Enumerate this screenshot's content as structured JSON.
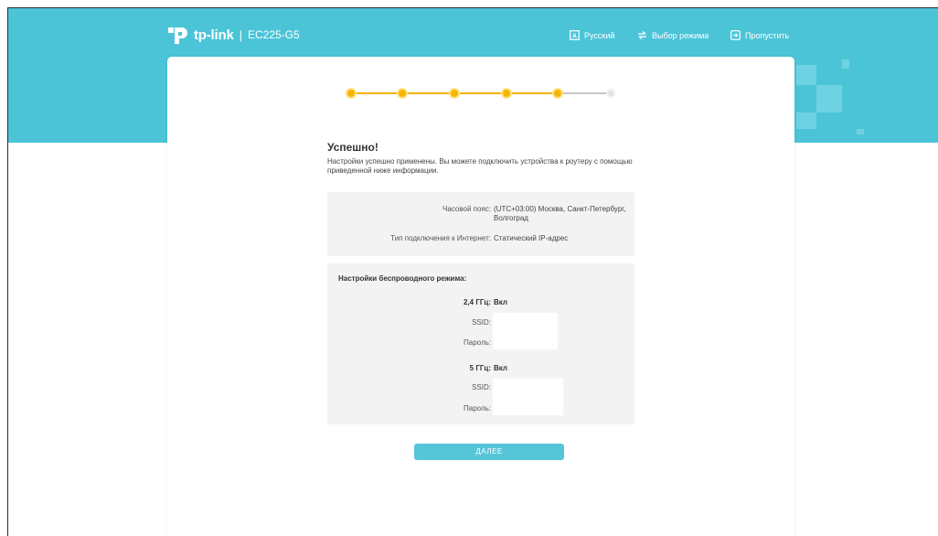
{
  "header": {
    "logo_text": "tp-link",
    "separator": "|",
    "model": "EC225-G5",
    "nav": [
      {
        "label": "Русский",
        "icon": "language-icon"
      },
      {
        "label": "Выбор режима",
        "icon": "mode-switch-icon"
      },
      {
        "label": "Пропустить",
        "icon": "skip-icon"
      }
    ]
  },
  "stepper": {
    "total": 6,
    "completed": 5
  },
  "main": {
    "title": "Успешно!",
    "description": "Настройки успешно применены. Вы можете подключить устройства к роутеру с помощью приведенной ниже информации.",
    "summary": {
      "timezone_label": "Часовой пояс:",
      "timezone_value": "(UTC+03:00) Москва, Санкт-Петербург, Волгоград",
      "connection_label": "Тип подключения к Интернет:",
      "connection_value": "Статический IP-адрес"
    },
    "wireless": {
      "section_label": "Настройки беспроводного режима:",
      "band24": {
        "label": "2,4 ГГц:",
        "status": "Вкл",
        "ssid_label": "SSID:",
        "password_label": "Пароль:"
      },
      "band5": {
        "label": "5 ГГц:",
        "status": "Вкл",
        "ssid_label": "SSID:",
        "password_label": "Пароль:"
      }
    },
    "next_button": "ДАЛЕЕ"
  },
  "colors": {
    "banner": "#4cc4d8",
    "accent": "#f6b500",
    "button": "#56c5d8"
  }
}
